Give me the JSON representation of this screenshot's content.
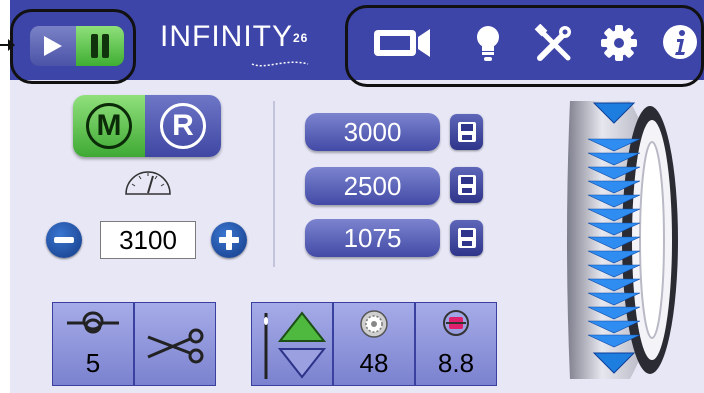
{
  "header": {
    "logo_text": "INFINITY",
    "logo_suffix": "26",
    "icons": [
      "video-camera-icon",
      "light-bulb-icon",
      "tools-icon",
      "gear-icon",
      "info-icon"
    ]
  },
  "controls": {
    "mode_left": "M",
    "mode_right": "R",
    "speed_value": "3100"
  },
  "presets": [
    "3000",
    "2500",
    "1075"
  ],
  "bottom": {
    "stitch_count": "5",
    "bobbin_count": "48",
    "thread_value": "8.8"
  },
  "colors": {
    "header_bg": "#3e45a8",
    "panel_bg": "#e7e7f6",
    "active_green": "#4fb83f",
    "button_blue": "#424aa6"
  }
}
